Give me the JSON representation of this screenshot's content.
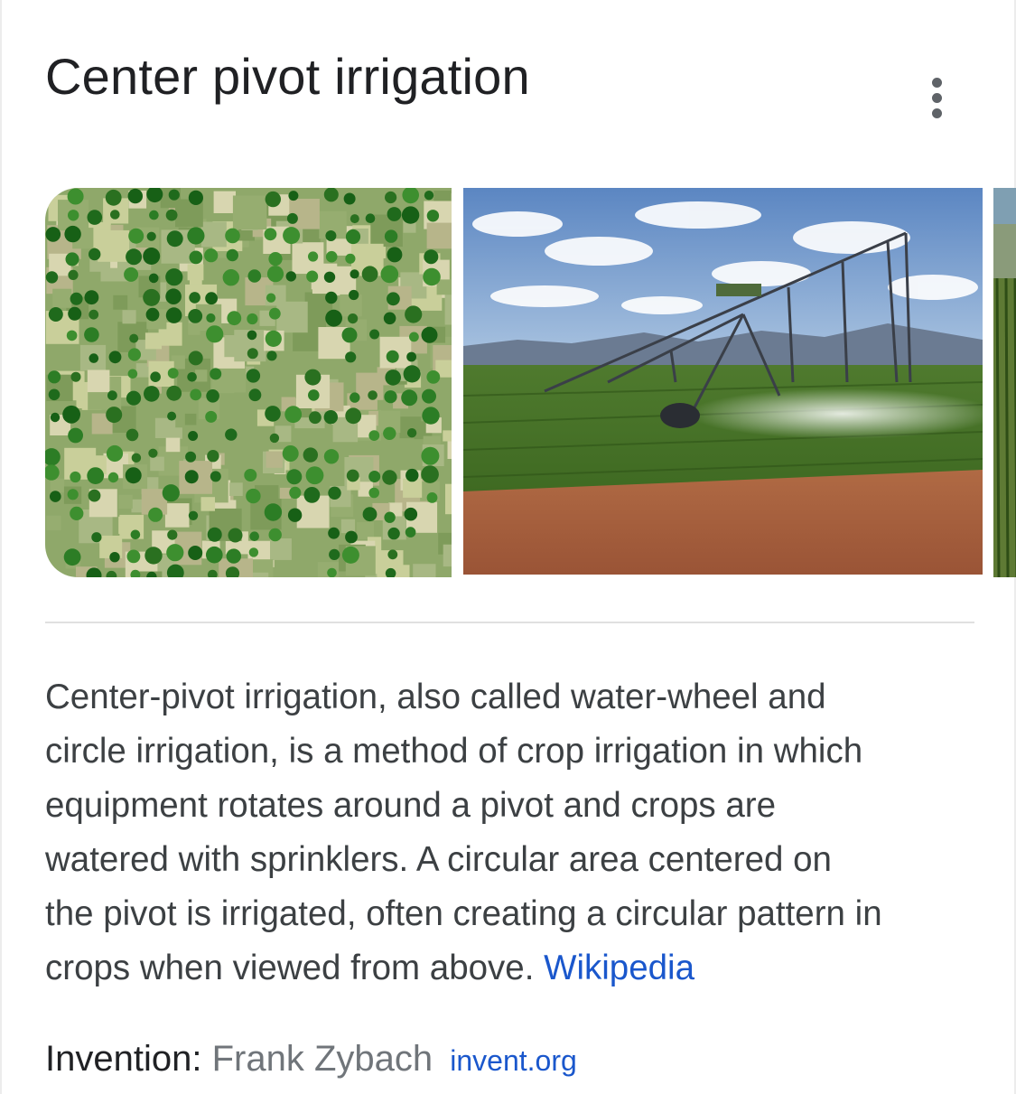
{
  "header": {
    "title": "Center pivot irrigation",
    "menu_icon": "more-vert-icon"
  },
  "images": [
    {
      "name": "aerial-crop-circles-image",
      "subject": "aerial view of circular irrigated fields"
    },
    {
      "name": "pivot-sprinkler-image",
      "subject": "center pivot sprinkler over crop field"
    },
    {
      "name": "crop-rows-image",
      "subject": "partially visible crop rows"
    }
  ],
  "description": {
    "lines": [
      "Center-pivot irrigation, also called water-wheel and",
      "circle irrigation, is a method of crop irrigation in which",
      "equipment rotates around a pivot and crops are",
      "watered with sprinklers. A circular area centered on",
      "the pivot is irrigated, often creating a circular pattern in",
      "crops when viewed from above."
    ],
    "source_link": "Wikipedia"
  },
  "facts": [
    {
      "label": "Invention:",
      "value": "Frank Zybach",
      "source": "invent.org"
    }
  ],
  "colors": {
    "link": "#1a57cc",
    "text": "#202124",
    "muted": "#70757a"
  }
}
